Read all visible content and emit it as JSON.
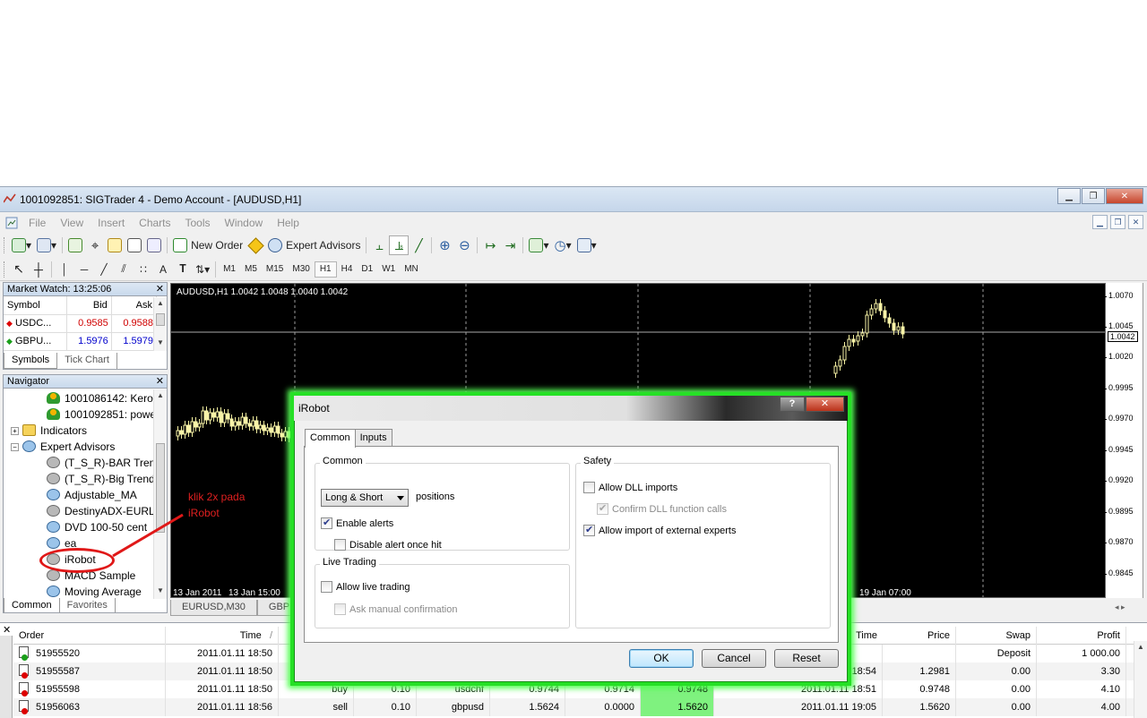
{
  "window": {
    "title": "1001092851: SIGTrader 4 - Demo Account - [AUDUSD,H1]"
  },
  "menu": [
    "File",
    "View",
    "Insert",
    "Charts",
    "Tools",
    "Window",
    "Help"
  ],
  "toolbar": {
    "new_order": "New Order",
    "expert_advisors": "Expert Advisors",
    "timeframes": [
      "M1",
      "M5",
      "M15",
      "M30",
      "H1",
      "H4",
      "D1",
      "W1",
      "MN"
    ],
    "active_timeframe": "H1"
  },
  "market_watch": {
    "title": "Market Watch: 13:25:06",
    "columns": [
      "Symbol",
      "Bid",
      "Ask"
    ],
    "rows": [
      {
        "symbol": "USDC...",
        "bid": "0.9585",
        "ask": "0.9588",
        "color": "#d00000"
      },
      {
        "symbol": "GBPU...",
        "bid": "1.5976",
        "ask": "1.5979",
        "color": "#0000cc"
      }
    ],
    "tabs": [
      "Symbols",
      "Tick Chart"
    ]
  },
  "navigator": {
    "title": "Navigator",
    "items": [
      {
        "label": "1001086142: Keror",
        "icon": "account-icon"
      },
      {
        "label": "1001092851: powe",
        "icon": "account-icon"
      },
      {
        "label": "Indicators",
        "icon": "indicators-folder-icon"
      },
      {
        "label": "Expert Advisors",
        "icon": "expert-advisors-folder-icon"
      },
      {
        "label": "(T_S_R)-BAR Tren",
        "icon": "expert-icon"
      },
      {
        "label": "(T_S_R)-Big Trend",
        "icon": "expert-icon"
      },
      {
        "label": "Adjustable_MA",
        "icon": "expert-icon"
      },
      {
        "label": "DestinyADX-EURL",
        "icon": "expert-icon"
      },
      {
        "label": "DVD 100-50 cent",
        "icon": "expert-icon"
      },
      {
        "label": "ea",
        "icon": "expert-icon"
      },
      {
        "label": "iRobot",
        "icon": "expert-icon"
      },
      {
        "label": "MACD Sample",
        "icon": "expert-icon"
      },
      {
        "label": "Moving Average",
        "icon": "expert-icon"
      }
    ],
    "tabs": [
      "Common",
      "Favorites"
    ]
  },
  "annotation": {
    "line1": "klik 2x pada",
    "line2": "iRobot"
  },
  "chart": {
    "label": "AUDUSD,H1  1.0042 1.0048 1.0040 1.0042",
    "price_ticks": [
      "1.0070",
      "1.0045",
      "1.0020",
      "0.9995",
      "0.9970",
      "0.9945",
      "0.9920",
      "0.9895",
      "0.9870",
      "0.9845"
    ],
    "current_price": "1.0042",
    "time_ticks": [
      "13 Jan 2011",
      "13 Jan 15:00",
      "19 Jan 07:00"
    ],
    "tabs": [
      "EURUSD,M30",
      "GBPUS"
    ]
  },
  "dialog": {
    "title": "iRobot",
    "tabs": [
      "Common",
      "Inputs"
    ],
    "common_group": "Common",
    "positions_select": "Long & Short",
    "positions_label": "positions",
    "enable_alerts": "Enable alerts",
    "disable_alert_once": "Disable alert once hit",
    "live_group": "Live Trading",
    "allow_live": "Allow live trading",
    "ask_manual": "Ask manual confirmation",
    "safety_group": "Safety",
    "allow_dll": "Allow DLL imports",
    "confirm_dll": "Confirm DLL function calls",
    "allow_import": "Allow import of external experts",
    "ok": "OK",
    "cancel": "Cancel",
    "reset": "Reset"
  },
  "terminal": {
    "headers": {
      "order": "Order",
      "time": "Time",
      "time_sort": "/",
      "time2": "Time",
      "price": "Price",
      "swap": "Swap",
      "profit": "Profit"
    },
    "rows": [
      {
        "order": "51955520",
        "time": "2011.01.11 18:50",
        "type": "",
        "size": "",
        "symbol": "",
        "price": "",
        "sl": "",
        "tp": "",
        "time2": "",
        "price2": "",
        "swap": "Deposit",
        "profit": "1 000.00",
        "kind": "deposit"
      },
      {
        "order": "51955587",
        "time": "2011.01.11 18:50",
        "type": "",
        "size": "",
        "symbol": "",
        "price": "",
        "sl": "",
        "tp": "",
        "time2": "18:54",
        "price2": "1.2981",
        "swap": "0.00",
        "profit": "3.30",
        "kind": "trade"
      },
      {
        "order": "51955598",
        "time": "2011.01.11 18:50",
        "type": "buy",
        "size": "0.10",
        "symbol": "usdchf",
        "price": "0.9744",
        "sl": "0.9714",
        "tp": "0.9748",
        "time2": "2011.01.11 18:51",
        "price2": "0.9748",
        "swap": "0.00",
        "profit": "4.10",
        "kind": "trade"
      },
      {
        "order": "51956063",
        "time": "2011.01.11 18:56",
        "type": "sell",
        "size": "0.10",
        "symbol": "gbpusd",
        "price": "1.5624",
        "sl": "0.0000",
        "tp": "1.5620",
        "time2": "2011.01.11 19:05",
        "price2": "1.5620",
        "swap": "0.00",
        "profit": "4.00",
        "kind": "trade"
      }
    ]
  }
}
